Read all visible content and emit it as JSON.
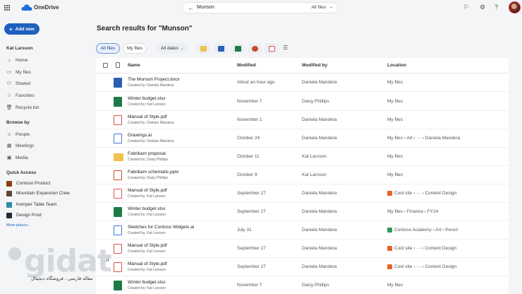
{
  "app": {
    "name": "OneDrive",
    "icons": [
      "waffle-icon",
      "onedrive-cloud-icon",
      "flag-icon",
      "gear-icon"
    ]
  },
  "search": {
    "query": "Munson",
    "scope": "All files"
  },
  "sidebar": {
    "new_button": "Add new",
    "user": "Kat Larsson",
    "items": [
      {
        "label": "Home",
        "icon": "home-icon"
      },
      {
        "label": "My files",
        "icon": "folder-icon"
      },
      {
        "label": "Shared",
        "icon": "people-icon"
      },
      {
        "label": "Favorites",
        "icon": "star-icon"
      },
      {
        "label": "Recycle bin",
        "icon": "trash-icon"
      }
    ],
    "browse_heading": "Browse by",
    "browse": [
      {
        "label": "People",
        "icon": "person-icon"
      },
      {
        "label": "Meetings",
        "icon": "calendar-icon"
      },
      {
        "label": "Media",
        "icon": "image-icon"
      }
    ],
    "quick_heading": "Quick Access",
    "quick": [
      {
        "label": "Contoso Product",
        "color": "#8a3b12"
      },
      {
        "label": "Mountain Expansion Crew",
        "color": "#5a4a3a"
      },
      {
        "label": "Kemper Table Team",
        "color": "#2a8fa8"
      },
      {
        "label": "Design Prod",
        "color": "#1e2a3a"
      }
    ],
    "more_places": "More places..."
  },
  "main": {
    "title": "Search results for \"Munson\"",
    "filters": {
      "all_files": "All files",
      "my_files": "My files",
      "dates": "All dates"
    },
    "type_filters": [
      {
        "name": "folder-type-icon",
        "color": "#f2c14e"
      },
      {
        "name": "word-type-icon",
        "color": "#2b5fb4"
      },
      {
        "name": "excel-type-icon",
        "color": "#1e7a45"
      },
      {
        "name": "powerpoint-type-icon",
        "color": "#c94a2a"
      },
      {
        "name": "pdf-type-icon",
        "color": "#d9534f"
      }
    ],
    "columns": {
      "name": "Name",
      "modified": "Modified",
      "modified_by": "Modified by",
      "location": "Location"
    }
  },
  "files": [
    {
      "name": "The Munson Project.docx",
      "created_by": "Created by: Daniela Mandera",
      "modified": "About an hour ago",
      "modified_by": "Daniela Mandera",
      "location": "My files",
      "icon": "word-file-icon",
      "icon_color": "#2b5fb4",
      "loc_icon": null
    },
    {
      "name": "Winter budget.xlsx",
      "created_by": "Created by: Kat Larsson",
      "modified": "November 7",
      "modified_by": "Daisy Phillips",
      "location": "My files",
      "icon": "excel-file-icon",
      "icon_color": "#1e7a45",
      "loc_icon": null
    },
    {
      "name": "Manual of Style.pdf",
      "created_by": "Created by: Daniela Mandera",
      "modified": "November 1",
      "modified_by": "Daniela Mandera",
      "location": "My files",
      "icon": "pdf-file-icon",
      "icon_color": "#d9534f",
      "loc_icon": null
    },
    {
      "name": "Drawings.ai",
      "created_by": "Created by: Daniela Mandera",
      "modified": "October 24",
      "modified_by": "Daniela Mandera",
      "location": "My files › Art › ··· › Daniela Mandera",
      "icon": "image-file-icon",
      "icon_color": "#3a7bd5",
      "loc_icon": null
    },
    {
      "name": "Fabrikam proposal",
      "created_by": "Created by: Daisy Phillips",
      "modified": "October 11",
      "modified_by": "Kat Larsson",
      "location": "My files",
      "icon": "folder-icon",
      "icon_color": "#f2c14e",
      "loc_icon": null
    },
    {
      "name": "Fabrikam schematic.pptx",
      "created_by": "Created by: Daisy Phillips",
      "modified": "October 9",
      "modified_by": "Kat Larsson",
      "location": "My files",
      "icon": "powerpoint-file-icon",
      "icon_color": "#c94a2a",
      "loc_icon": null
    },
    {
      "name": "Manual of Style.pdf",
      "created_by": "Created by: Kat Larsson",
      "modified": "September 27",
      "modified_by": "Daniela Mandera",
      "location": "Cool site › ··· › Content Design",
      "icon": "pdf-file-icon",
      "icon_color": "#d9534f",
      "loc_icon": "#e8622a"
    },
    {
      "name": "Winter budget.xlsx",
      "created_by": "Created by: Kat Larsson",
      "modified": "September 27",
      "modified_by": "Daniela Mandera",
      "location": "My files › Finance › FY24",
      "icon": "excel-file-icon",
      "icon_color": "#1e7a45",
      "loc_icon": null
    },
    {
      "name": "Sketches for Contoso Widgets.ai",
      "created_by": "Created by: Kat Larsson",
      "modified": "July 31",
      "modified_by": "Daniela Mandera",
      "location": "Contoso Academy › Art › Pencil",
      "icon": "image-file-icon",
      "icon_color": "#3a7bd5",
      "loc_icon": "#2e9a5a"
    },
    {
      "name": "Manual of Style.pdf",
      "created_by": "Created by: Kat Larsson",
      "modified": "September 27",
      "modified_by": "Daniela Mandera",
      "location": "Cool site › ··· › Content Design",
      "icon": "pdf-file-icon",
      "icon_color": "#d9534f",
      "loc_icon": "#e8622a"
    },
    {
      "name": "Manual of Style.pdf",
      "created_by": "Created by: Kat Larsson",
      "modified": "September 27",
      "modified_by": "Daniela Mandera",
      "location": "Cool site › ··· › Content Design",
      "icon": "pdf-file-icon",
      "icon_color": "#d9534f",
      "loc_icon": "#e8622a"
    },
    {
      "name": "Winter budget.xlsx",
      "created_by": "Created by: Kat Larsson",
      "modified": "November 7",
      "modified_by": "Daisy Phillips",
      "location": "My files",
      "icon": "excel-file-icon",
      "icon_color": "#1e7a45",
      "loc_icon": null
    }
  ],
  "watermark": {
    "logo": "gidat",
    "domain": ".ir",
    "tagline": "مقاله فارسی ، فروشگاه دیجیتال"
  }
}
